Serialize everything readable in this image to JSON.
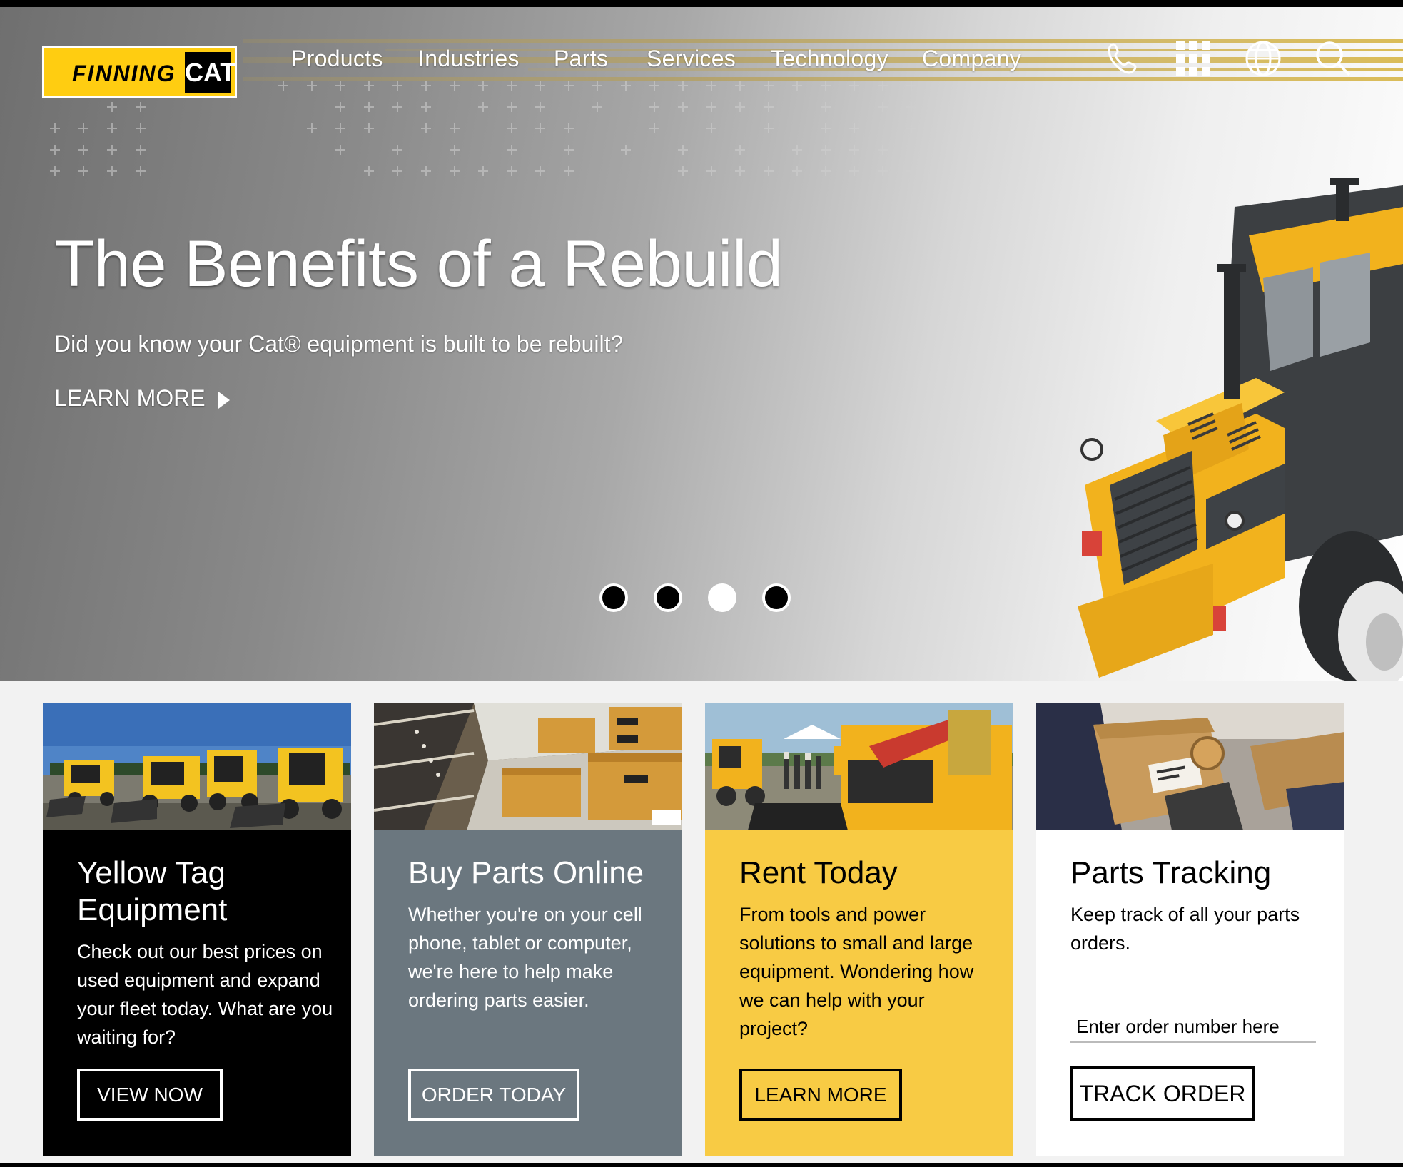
{
  "brand": {
    "logo_text": "FINNING",
    "logo_mark": "CAT",
    "colors": {
      "accent": "#ffcd11",
      "dark": "#000000",
      "slate": "#6b777f",
      "yellow_card": "#f8cb44"
    }
  },
  "nav": {
    "items": [
      "Products",
      "Industries",
      "Parts",
      "Services",
      "Technology",
      "Company"
    ],
    "icons": [
      "phone-icon",
      "apps-grid-icon",
      "globe-icon",
      "search-icon"
    ]
  },
  "hero": {
    "title": "The Benefits of a Rebuild",
    "subtitle": "Did you know your Cat® equipment is built to be rebuilt?",
    "cta": "LEARN MORE",
    "carousel_count": 4,
    "carousel_active_index": 2
  },
  "cards": [
    {
      "title": "Yellow Tag Equipment",
      "text": "Check out our best prices on used equipment and expand your fleet today. What are you waiting for?",
      "button": "VIEW NOW",
      "bg": "#000000",
      "fg": "#ffffff"
    },
    {
      "title": "Buy Parts Online",
      "text": "Whether you're on your cell phone, tablet or computer, we're here to help make ordering parts easier.",
      "button": "ORDER TODAY",
      "bg": "#6b777f",
      "fg": "#ffffff"
    },
    {
      "title": "Rent Today",
      "text": "From tools and power solutions to small and large equipment. Wondering how we can help with your project?",
      "button": "LEARN MORE",
      "bg": "#f8cb44",
      "fg": "#000000"
    },
    {
      "title": "Parts Tracking",
      "text": "Keep track of all your parts orders.",
      "input_placeholder": "Enter order number here",
      "input_value": "",
      "button": "TRACK ORDER",
      "bg": "#ffffff",
      "fg": "#000000"
    }
  ]
}
